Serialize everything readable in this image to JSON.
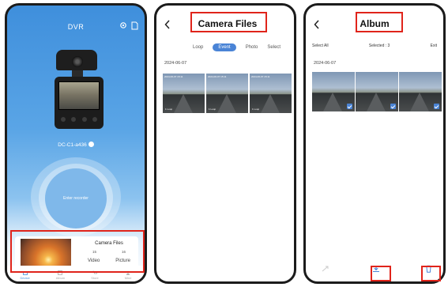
{
  "colors": {
    "accent": "#4a84d6",
    "annotation": "#e0241b",
    "phone_frame": "#1b1b1b",
    "home_gradient_top": "#3f8fdc"
  },
  "home": {
    "title": "DVR",
    "device_name": "DC-C1-a436",
    "enter_button": "Enter recorder",
    "camera_files": {
      "title": "Camera Files",
      "video_count": "15",
      "picture_count": "16",
      "video_label": "Video",
      "picture_label": "Picture"
    },
    "tabs": [
      {
        "label": "Device",
        "icon": "camera-icon"
      },
      {
        "label": "Album",
        "icon": "album-icon"
      },
      {
        "label": "Store",
        "icon": "cart-icon"
      },
      {
        "label": "Mine",
        "icon": "person-icon"
      }
    ]
  },
  "camera_files_screen": {
    "title": "Camera Files",
    "filters": [
      "Loop",
      "Event",
      "Photo",
      "Select"
    ],
    "active_filter": "Event",
    "date": "2024-06-07",
    "thumbs": [
      {
        "stamp": "2024-06-07 15:11",
        "tag": "1 Loop"
      },
      {
        "stamp": "2024-06-07 15:11",
        "tag": "1 Loop"
      },
      {
        "stamp": "2024-06-07 15:11",
        "tag": "1 Loop"
      }
    ]
  },
  "album_screen": {
    "title": "Album",
    "select_all": "Select All",
    "selected": "Selected : 3",
    "exit": "Exit",
    "date": "2024-06-07",
    "thumb_count": 3
  }
}
